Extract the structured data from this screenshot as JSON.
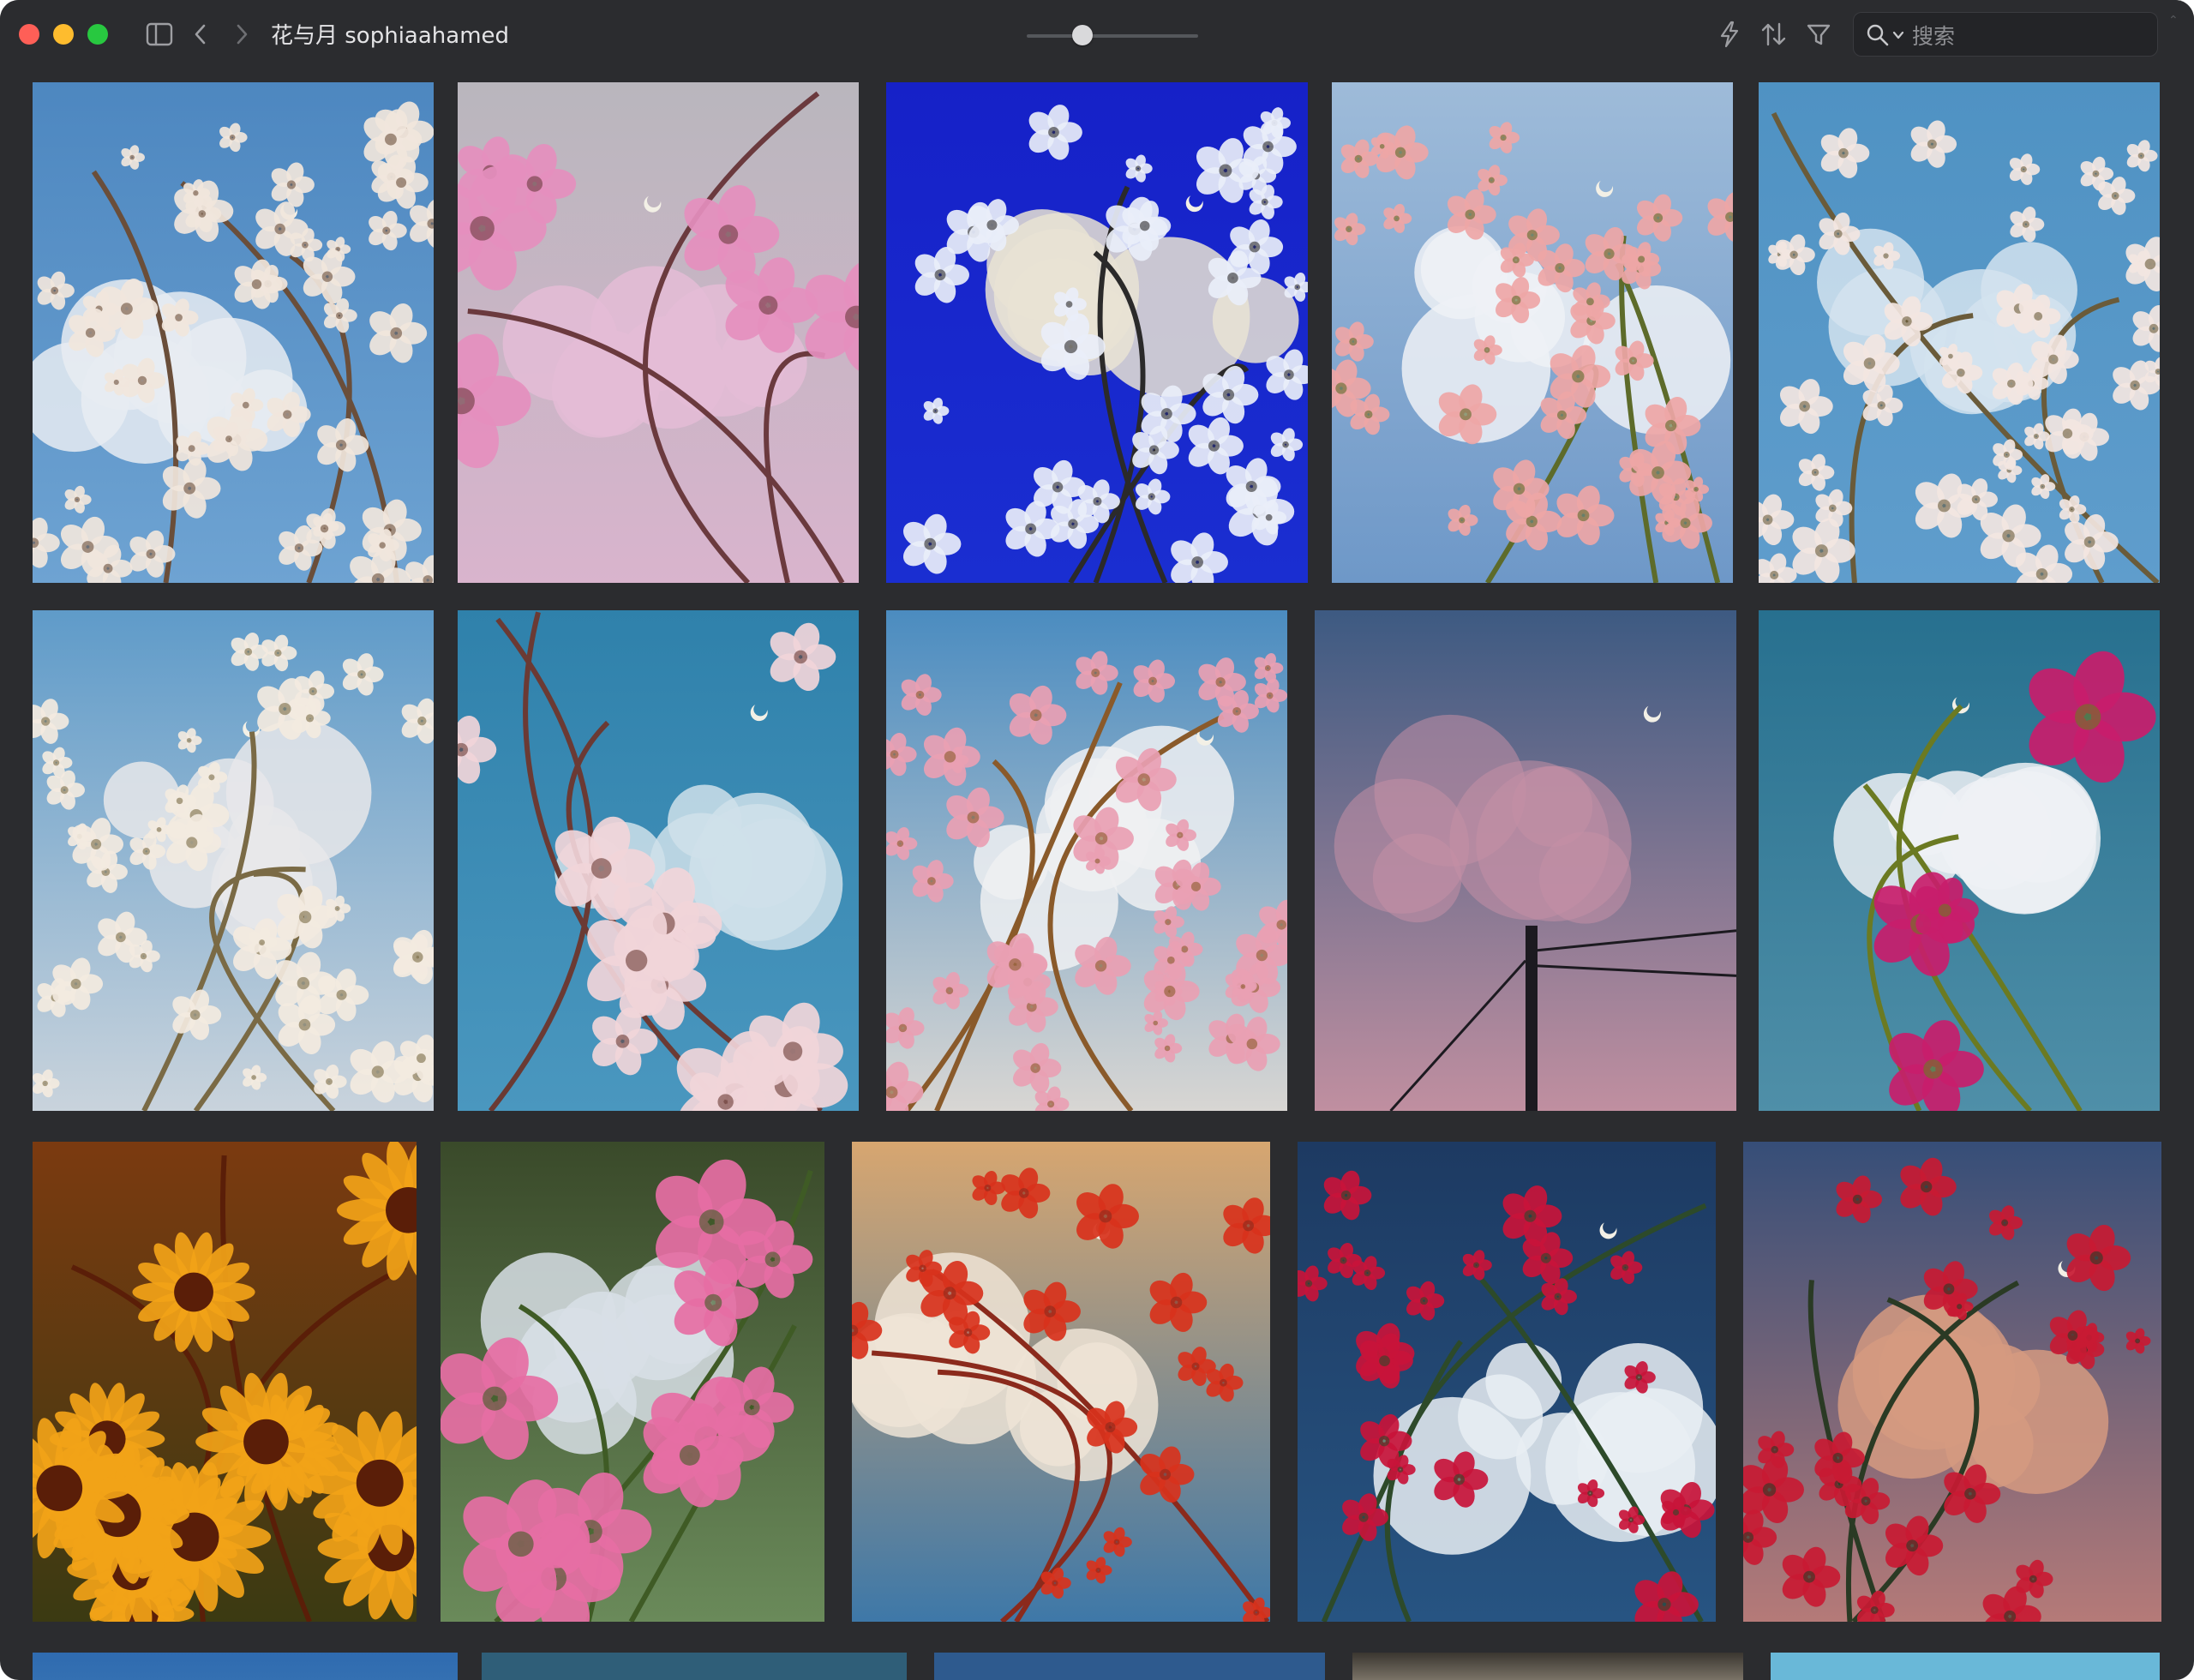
{
  "window": {
    "title": "花与月 sophiaahamed"
  },
  "toolbar": {
    "zoom_level": 0.3,
    "search_placeholder": "搜索",
    "icons": [
      "sidebar-toggle-icon",
      "back-chevron-icon",
      "forward-chevron-icon",
      "lightning-icon",
      "sort-icon",
      "filter-icon",
      "search-icon"
    ]
  },
  "gallery": {
    "photos": [
      {
        "subject": "white cherry blossoms, blue sky, cloud"
      },
      {
        "subject": "pink magnolia, pastel sky"
      },
      {
        "subject": "white blossoms on deep blue sky"
      },
      {
        "subject": "pink blossoms with clouds"
      },
      {
        "subject": "hanging white blossoms, blue sky"
      },
      {
        "subject": "white blossoms with cloud"
      },
      {
        "subject": "magnolia on teal sky"
      },
      {
        "subject": "pink double cherry blossoms"
      },
      {
        "subject": "pink clouds, utility pole"
      },
      {
        "subject": "magenta dahlias with cloud"
      },
      {
        "subject": "orange sunflowers"
      },
      {
        "subject": "pink roses"
      },
      {
        "subject": "red flowers, orange clouds"
      },
      {
        "subject": "red roses, night cloud"
      },
      {
        "subject": "red roses at dusk"
      },
      {
        "subject": "partial photo"
      },
      {
        "subject": "partial photo"
      },
      {
        "subject": "partial photo"
      },
      {
        "subject": "partial photo"
      },
      {
        "subject": "partial photo"
      }
    ]
  }
}
